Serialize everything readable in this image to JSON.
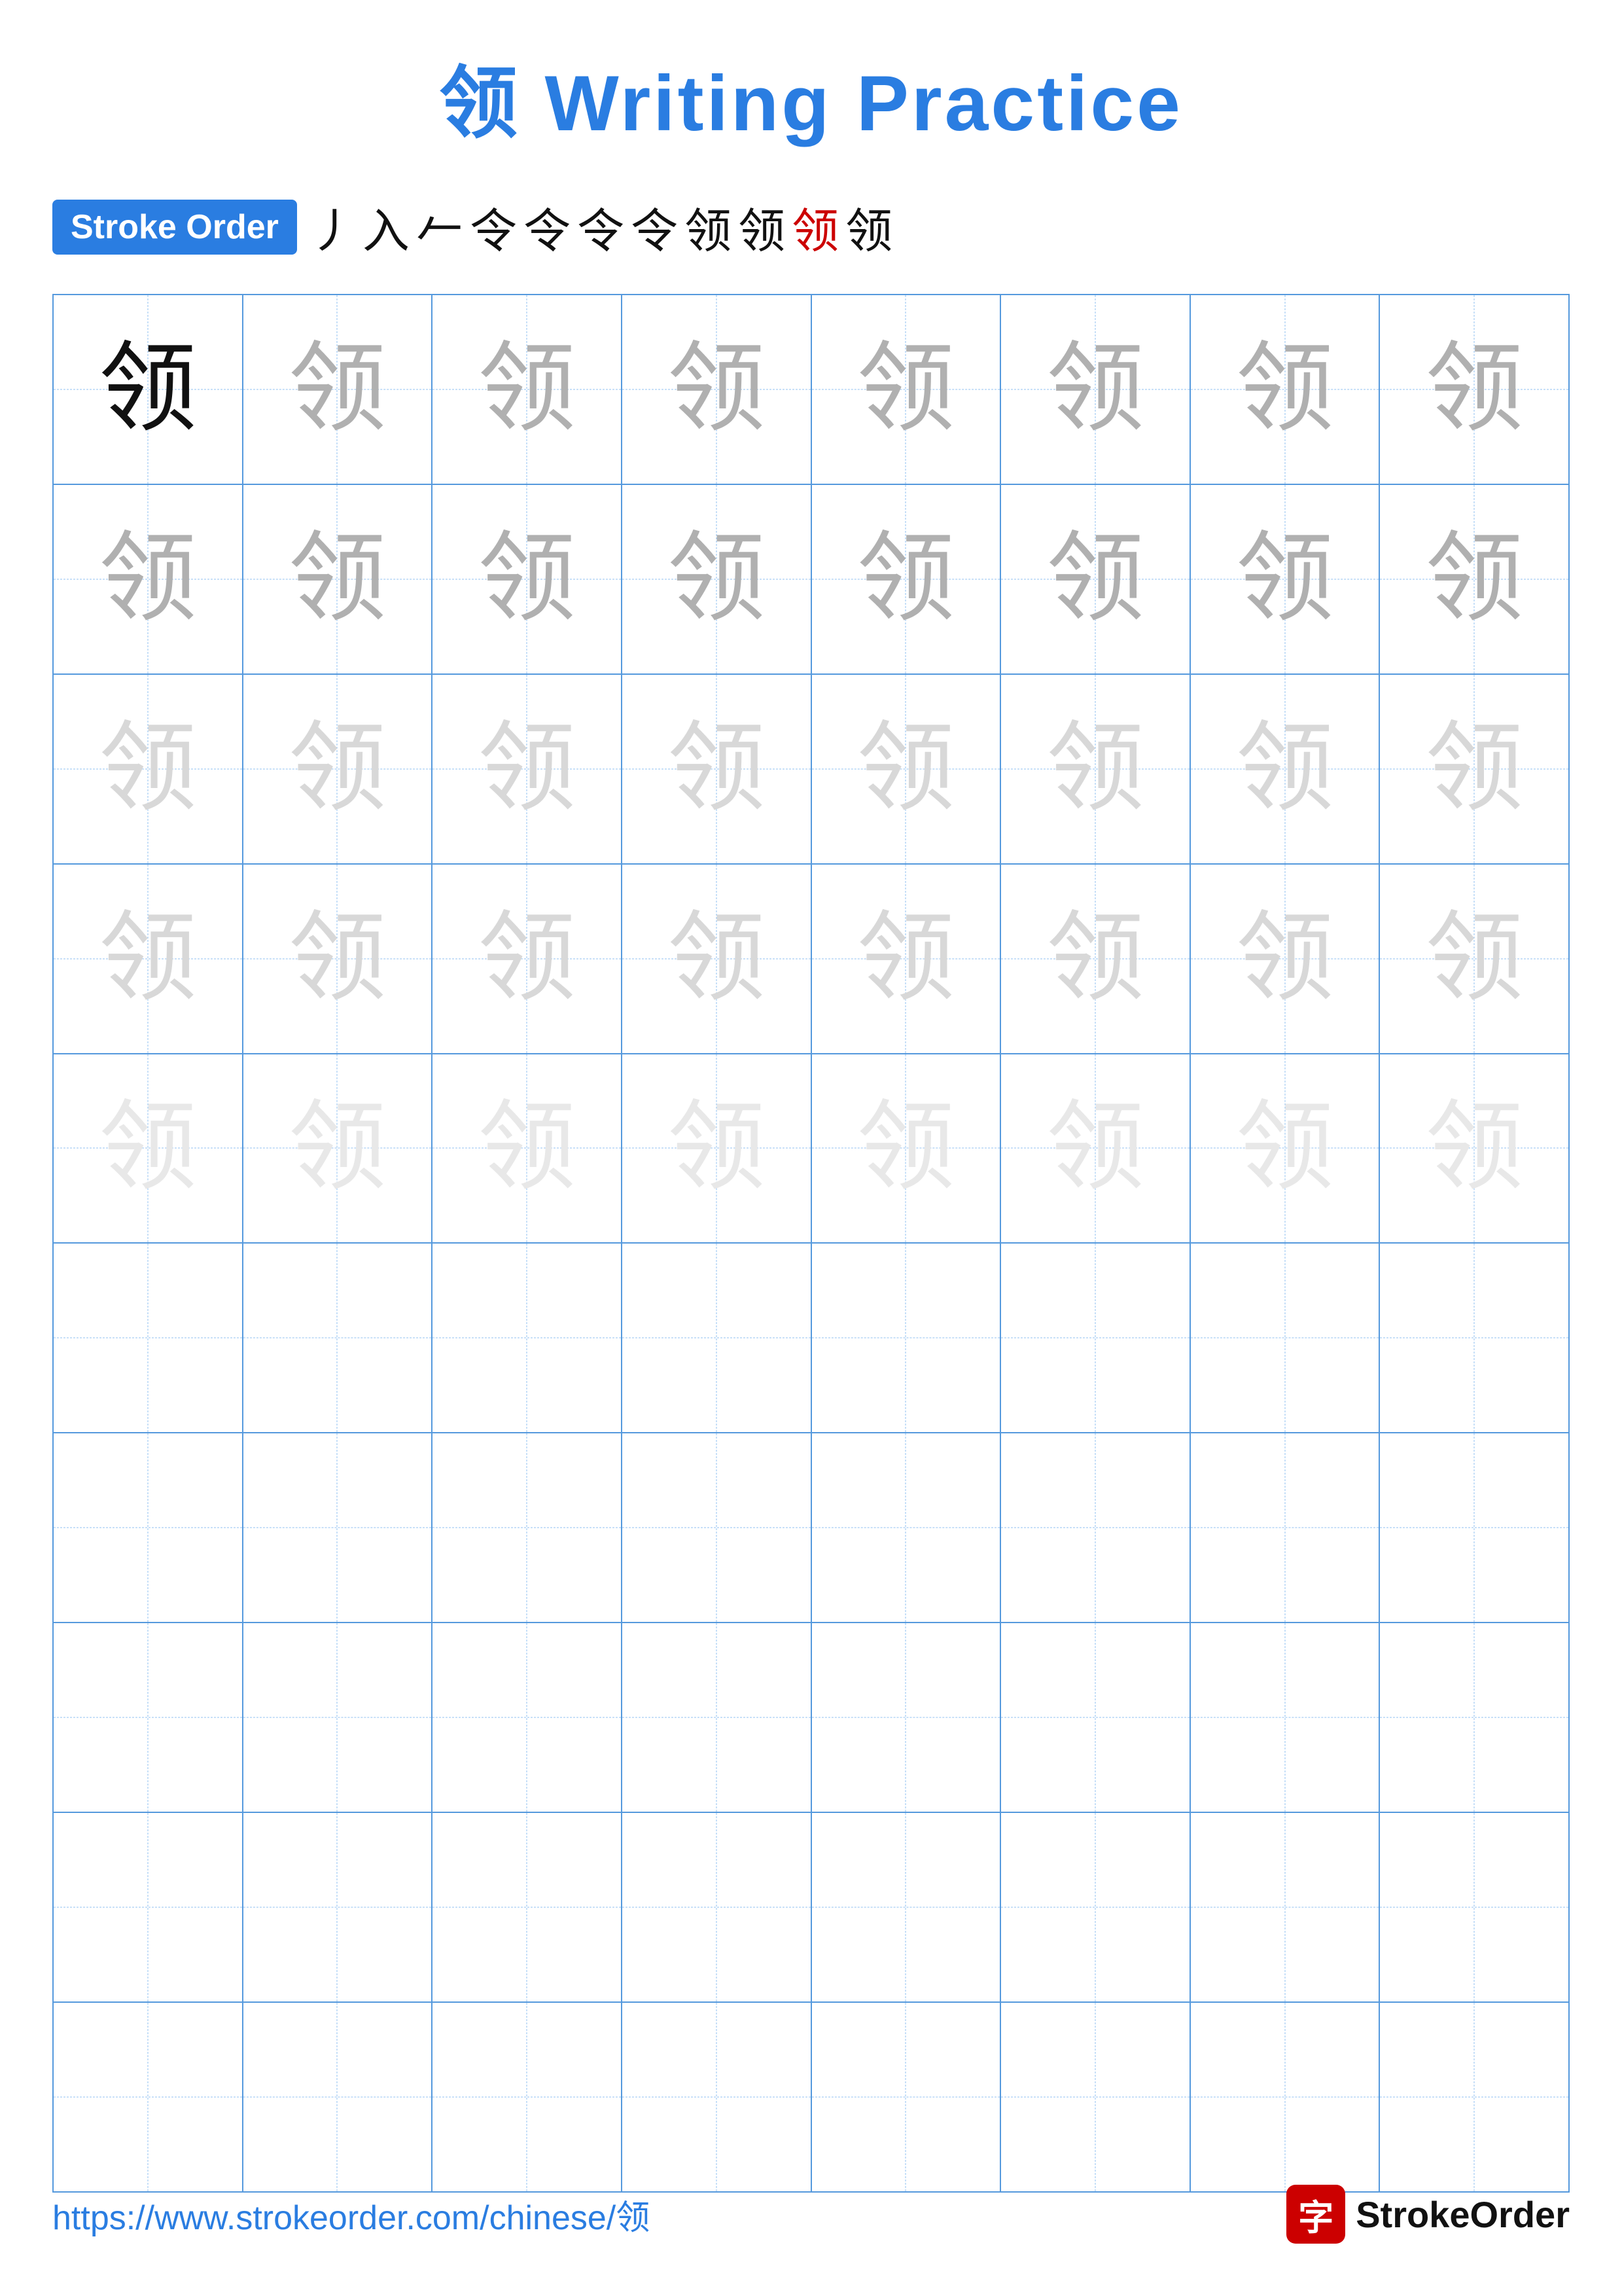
{
  "title": {
    "char": "领",
    "text": " Writing Practice"
  },
  "stroke_order": {
    "badge_label": "Stroke Order",
    "strokes": [
      "丿",
      "入",
      "𠂉",
      "令",
      "令",
      "令-",
      "令̄",
      "令̈",
      "领̧",
      "领",
      "领"
    ]
  },
  "grid": {
    "rows": 10,
    "cols": 8,
    "char": "领",
    "practice_char": "领",
    "row_data": [
      [
        "dark",
        "medium",
        "medium",
        "medium",
        "medium",
        "medium",
        "medium",
        "medium"
      ],
      [
        "medium",
        "medium",
        "medium",
        "medium",
        "medium",
        "medium",
        "medium",
        "medium"
      ],
      [
        "light",
        "light",
        "light",
        "light",
        "light",
        "light",
        "light",
        "light"
      ],
      [
        "light",
        "light",
        "light",
        "light",
        "light",
        "light",
        "light",
        "light"
      ],
      [
        "very-light",
        "very-light",
        "very-light",
        "very-light",
        "very-light",
        "very-light",
        "very-light",
        "very-light"
      ],
      [
        "empty",
        "empty",
        "empty",
        "empty",
        "empty",
        "empty",
        "empty",
        "empty"
      ],
      [
        "empty",
        "empty",
        "empty",
        "empty",
        "empty",
        "empty",
        "empty",
        "empty"
      ],
      [
        "empty",
        "empty",
        "empty",
        "empty",
        "empty",
        "empty",
        "empty",
        "empty"
      ],
      [
        "empty",
        "empty",
        "empty",
        "empty",
        "empty",
        "empty",
        "empty",
        "empty"
      ],
      [
        "empty",
        "empty",
        "empty",
        "empty",
        "empty",
        "empty",
        "empty",
        "empty"
      ]
    ]
  },
  "footer": {
    "url": "https://www.strokeorder.com/chinese/领",
    "logo_char": "字",
    "logo_text": "StrokeOrder"
  },
  "colors": {
    "blue": "#2a7de1",
    "red": "#cc0000",
    "dark_char": "#111111",
    "medium_char": "#b0b0b0",
    "light_char": "#d0d0d0",
    "very_light_char": "#e5e5e5"
  }
}
